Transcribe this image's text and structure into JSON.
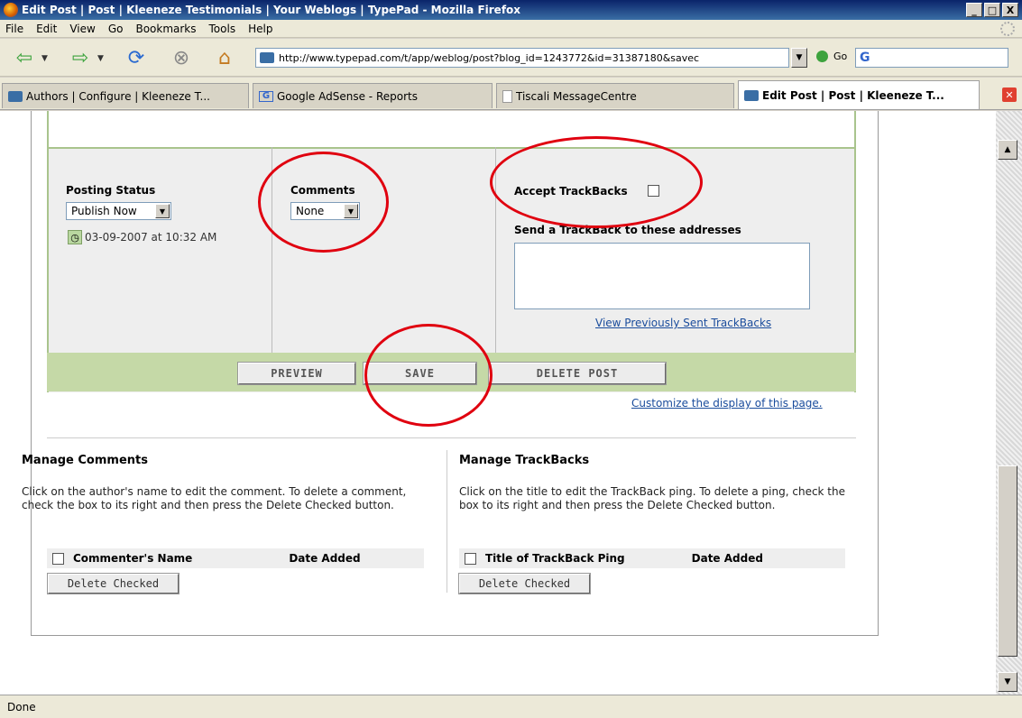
{
  "window": {
    "title": "Edit Post | Post | Kleeneze Testimonials | Your Weblogs | TypePad - Mozilla Firefox",
    "controls": [
      "_",
      "□",
      "X"
    ]
  },
  "menu": [
    "File",
    "Edit",
    "View",
    "Go",
    "Bookmarks",
    "Tools",
    "Help"
  ],
  "nav": {
    "url": "http://www.typepad.com/t/app/weblog/post?blog_id=1243772&id=31387180&savec",
    "go_label": "Go",
    "search_value": "G"
  },
  "tabs": [
    {
      "label": "Authors | Configure | Kleeneze T..."
    },
    {
      "label": "Google AdSense - Reports"
    },
    {
      "label": "Tiscali MessageCentre"
    },
    {
      "label": "Edit Post | Post | Kleeneze T..."
    }
  ],
  "edit": {
    "posting_status_label": "Posting Status",
    "posting_status_value": "Publish Now",
    "timestamp": "03-09-2007 at 10:32 AM",
    "comments_label": "Comments",
    "comments_value": "None",
    "accept_trackbacks_label": "Accept TrackBacks",
    "send_trackback_label": "Send a TrackBack to these addresses",
    "view_sent_link": "View Previously Sent TrackBacks",
    "preview_btn": "PREVIEW",
    "save_btn": "SAVE",
    "delete_btn": "DELETE POST",
    "customize_link": "Customize the display of this page."
  },
  "manage_comments": {
    "heading": "Manage Comments",
    "text": "Click on the author's name to edit the comment. To delete a comment, check the box to its right and then press the Delete Checked button.",
    "col_name": "Commenter's Name",
    "col_date": "Date Added",
    "delete_btn": "Delete Checked"
  },
  "manage_trackbacks": {
    "heading": "Manage TrackBacks",
    "text": "Click on the title to edit the TrackBack ping. To delete a ping, check the box to its right and then press the Delete Checked button.",
    "col_name": "Title of TrackBack Ping",
    "col_date": "Date Added",
    "delete_btn": "Delete Checked"
  },
  "status": "Done",
  "colors": {
    "panel_border": "#a9c48d",
    "button_bar": "#c5d9a7",
    "annotation_red": "#e0000f",
    "link": "#1a4c9c"
  }
}
